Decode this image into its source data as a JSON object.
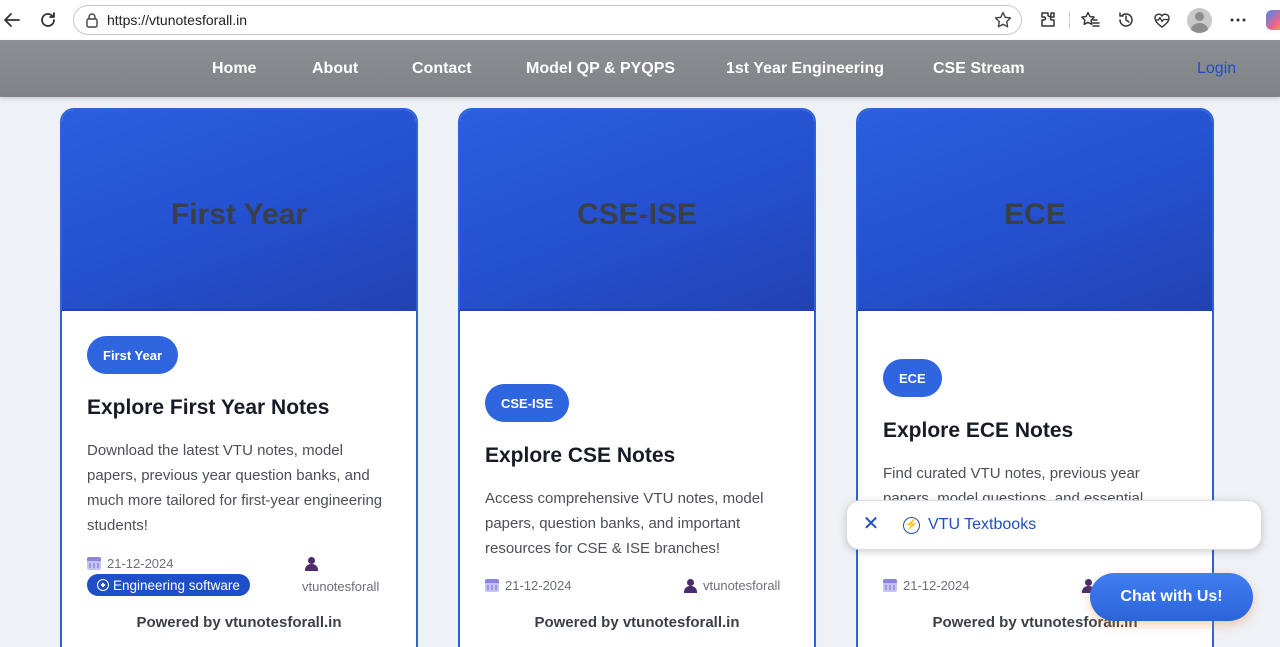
{
  "browser": {
    "url": "https://vtunotesforall.in"
  },
  "site": {
    "nav": [
      "Home",
      "About",
      "Contact",
      "Model QP & PYQPS",
      "1st Year Engineering",
      "CSE Stream"
    ],
    "login": "Login"
  },
  "cards": [
    {
      "hero": "First Year",
      "badge": "First Year",
      "title": "Explore First Year Notes",
      "desc": "Download the latest VTU notes, model papers, previous year question banks, and much more tailored for first-year engineering students!",
      "date": "21-12-2024",
      "author": "vtunotesforall",
      "tag": "Engineering software",
      "powered": "Powered by vtunotesforall.in"
    },
    {
      "hero": "CSE-ISE",
      "badge": "CSE-ISE",
      "title": "Explore CSE Notes",
      "desc": "Access comprehensive VTU notes, model papers, question banks, and important resources for CSE & ISE branches!",
      "date": "21-12-2024",
      "author": "vtunotesforall",
      "powered": "Powered by vtunotesforall.in"
    },
    {
      "hero": "ECE",
      "badge": "ECE",
      "title": "Explore ECE Notes",
      "desc": "Find curated VTU notes, previous year papers, model questions, and essential resources for ECE students!",
      "date": "21-12-2024",
      "author": "vtunotesforall",
      "powered": "Powered by vtunotesforall.in"
    }
  ],
  "suggestion": {
    "label": "VTU Textbooks"
  },
  "chat": {
    "label": "Chat with Us!"
  }
}
